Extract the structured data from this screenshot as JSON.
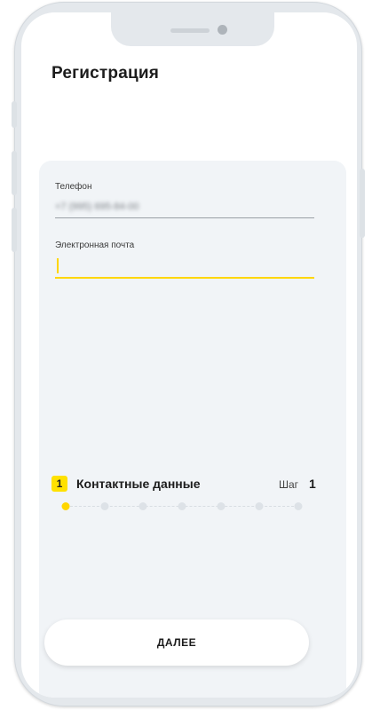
{
  "screen": {
    "title": "Регистрация"
  },
  "form": {
    "phone": {
      "label": "Телефон",
      "value": "+7 (995) 695-84-00"
    },
    "email": {
      "label": "Электронная почта",
      "value": "",
      "placeholder": ""
    }
  },
  "step": {
    "badge": "1",
    "title": "Контактные данные",
    "step_word": "Шаг",
    "step_number": "1",
    "total_dots": 7,
    "active_index": 0
  },
  "actions": {
    "next_label": "ДАЛЕЕ"
  },
  "colors": {
    "accent": "#ffd600",
    "card_bg": "#f1f4f7",
    "phone_frame": "#e4e8ec"
  }
}
